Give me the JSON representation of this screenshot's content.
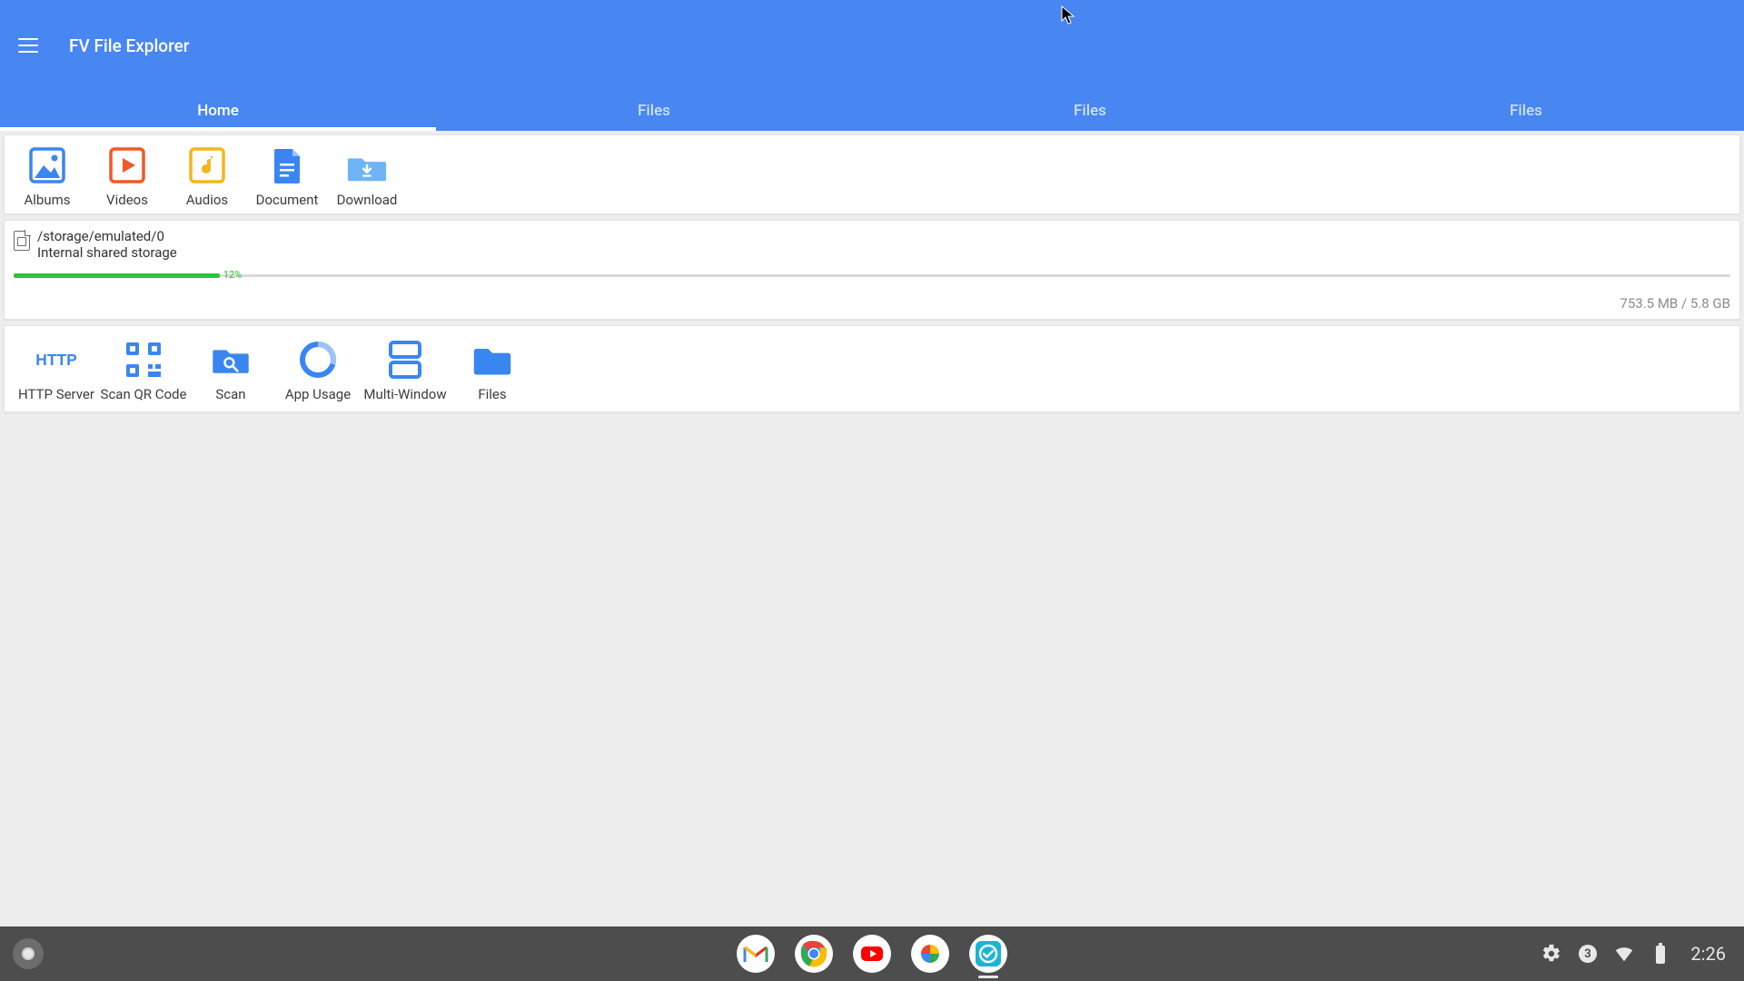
{
  "app": {
    "title": "FV File Explorer"
  },
  "tabs": [
    {
      "label": "Home",
      "active": true
    },
    {
      "label": "Files",
      "active": false
    },
    {
      "label": "Files",
      "active": false
    },
    {
      "label": "Files",
      "active": false
    }
  ],
  "media_shortcuts": [
    {
      "key": "albums",
      "label": "Albums"
    },
    {
      "key": "videos",
      "label": "Videos"
    },
    {
      "key": "audios",
      "label": "Audios"
    },
    {
      "key": "document",
      "label": "Document"
    },
    {
      "key": "download",
      "label": "Download"
    }
  ],
  "storage": {
    "path": "/storage/emulated/0",
    "name": "Internal shared storage",
    "percent_label": "12%",
    "percent_value": 12,
    "used": "753.5 MB",
    "total": "5.8 GB",
    "size_line": "753.5 MB  /  5.8 GB"
  },
  "tools": [
    {
      "key": "http",
      "label": "HTTP Server"
    },
    {
      "key": "qr",
      "label": "Scan QR Code"
    },
    {
      "key": "scan",
      "label": "Scan"
    },
    {
      "key": "usage",
      "label": "App Usage"
    },
    {
      "key": "multi",
      "label": "Multi-Window"
    },
    {
      "key": "files",
      "label": "Files"
    }
  ],
  "shelf": {
    "apps": [
      {
        "key": "gmail",
        "name": "Gmail"
      },
      {
        "key": "chrome",
        "name": "Chrome"
      },
      {
        "key": "youtube",
        "name": "YouTube"
      },
      {
        "key": "photos",
        "name": "Photos"
      },
      {
        "key": "fv",
        "name": "FV File Explorer",
        "active": true
      }
    ],
    "notification_count": "3",
    "clock": "2:26"
  },
  "colors": {
    "accent": "#4886f2",
    "icon_blue": "#3a86f0",
    "progress": "#28c43f"
  }
}
